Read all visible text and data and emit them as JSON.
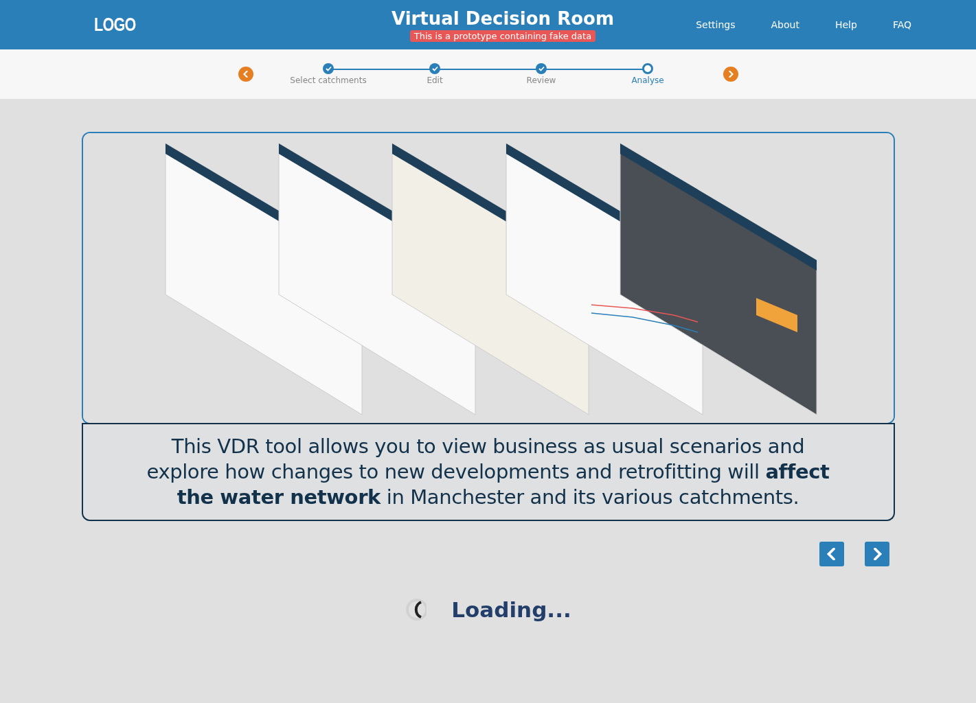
{
  "header": {
    "logo": "LOGO",
    "title": "Virtual Decision Room",
    "banner": "This is a prototype containing fake data",
    "nav": [
      "Settings",
      "About",
      "Help",
      "FAQ"
    ]
  },
  "stepper": {
    "steps": [
      {
        "label": "Select catchments",
        "completed": true,
        "selected": false
      },
      {
        "label": "Edit",
        "completed": true,
        "selected": false
      },
      {
        "label": "Review",
        "completed": true,
        "selected": false
      },
      {
        "label": "Analyse",
        "completed": false,
        "selected": true
      }
    ]
  },
  "showcase": {
    "caption": "This VDR tool allows you to view business as usual scenarios and explore how changes to new developments and retrofitting will **affect the water network** in Manchester and its various catchments."
  },
  "loading": {
    "text": "Loading..."
  }
}
